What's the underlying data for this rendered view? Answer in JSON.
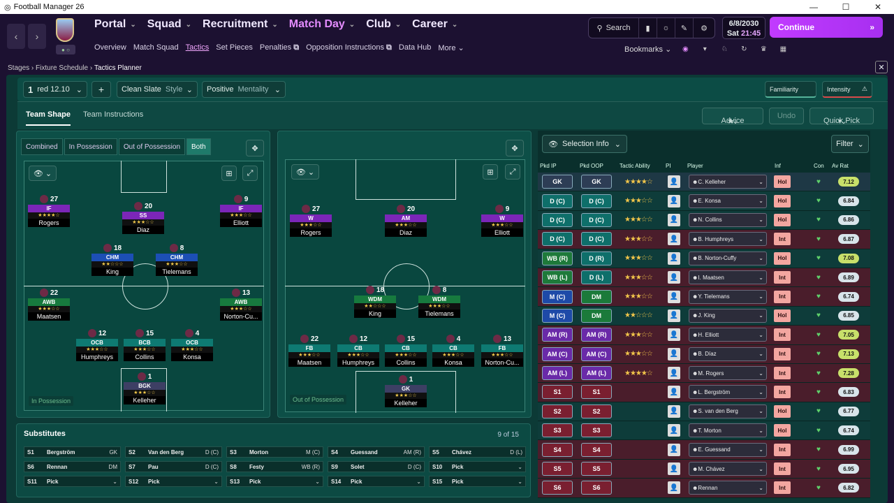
{
  "window": {
    "title": "Football Manager 26"
  },
  "nav": {
    "main": [
      {
        "label": "Portal"
      },
      {
        "label": "Squad"
      },
      {
        "label": "Recruitment"
      },
      {
        "label": "Match Day"
      },
      {
        "label": "Club"
      },
      {
        "label": "Career"
      }
    ],
    "sub": [
      "Overview",
      "Match Squad",
      "Tactics",
      "Set Pieces",
      "Penalties",
      "Opposition Instructions",
      "Data Hub",
      "More"
    ],
    "search": "Search",
    "bookmarks": "Bookmarks",
    "date": "6/8/2030",
    "day": "Sat",
    "time": "21:45",
    "continue": "Continue"
  },
  "breadcrumb": [
    "Stages",
    "Fixture Schedule",
    "Tactics Planner"
  ],
  "toolbar": {
    "tactic_slot": "1",
    "tactic_name": "red 12.10",
    "style": "Clean Slate",
    "style_label": "Style",
    "mentality": "Positive",
    "mentality_label": "Mentality",
    "familiarity": "Familiarity",
    "intensity": "Intensity"
  },
  "tabs": {
    "team_shape": "Team Shape",
    "team_instructions": "Team Instructions",
    "advice": "Advice",
    "undo": "Undo",
    "quick_pick": "Quick Pick"
  },
  "view_modes": [
    "Combined",
    "In Possession",
    "Out of Possession",
    "Both"
  ],
  "pitch_labels": {
    "in": "In Possession",
    "out": "Out of Possession"
  },
  "in_possession": [
    {
      "num": "27",
      "role": "IF",
      "name": "Rogers",
      "stars": "★★★★☆"
    },
    {
      "num": "20",
      "role": "SS",
      "name": "Diaz",
      "stars": "★★★☆☆"
    },
    {
      "num": "9",
      "role": "IF",
      "name": "Elliott",
      "stars": "★★★☆☆"
    },
    {
      "num": "18",
      "role": "CHM",
      "name": "King",
      "stars": "★★☆☆☆"
    },
    {
      "num": "8",
      "role": "CHM",
      "name": "Tielemans",
      "stars": "★★★☆☆"
    },
    {
      "num": "22",
      "role": "AWB",
      "name": "Maatsen",
      "stars": "★★★☆☆"
    },
    {
      "num": "13",
      "role": "AWB",
      "name": "Norton-Cu...",
      "stars": "★★★☆☆"
    },
    {
      "num": "12",
      "role": "OCB",
      "name": "Humphreys",
      "stars": "★★★☆☆"
    },
    {
      "num": "15",
      "role": "BCB",
      "name": "Collins",
      "stars": "★★★☆☆"
    },
    {
      "num": "4",
      "role": "OCB",
      "name": "Konsa",
      "stars": "★★★☆☆"
    },
    {
      "num": "1",
      "role": "BGK",
      "name": "Kelleher",
      "stars": "★★★☆☆"
    }
  ],
  "out_possession": [
    {
      "num": "27",
      "role": "W",
      "name": "Rogers",
      "stars": "★★★☆☆"
    },
    {
      "num": "20",
      "role": "AM",
      "name": "Diaz",
      "stars": "★★★☆☆"
    },
    {
      "num": "9",
      "role": "W",
      "name": "Elliott",
      "stars": "★★★☆☆"
    },
    {
      "num": "18",
      "role": "WDM",
      "name": "King",
      "stars": "★★☆☆☆"
    },
    {
      "num": "8",
      "role": "WDM",
      "name": "Tielemans",
      "stars": "★★★☆☆"
    },
    {
      "num": "22",
      "role": "FB",
      "name": "Maatsen",
      "stars": "★★★☆☆"
    },
    {
      "num": "12",
      "role": "CB",
      "name": "Humphreys",
      "stars": "★★★☆☆"
    },
    {
      "num": "15",
      "role": "CB",
      "name": "Collins",
      "stars": "★★★☆☆"
    },
    {
      "num": "4",
      "role": "CB",
      "name": "Konsa",
      "stars": "★★★☆☆"
    },
    {
      "num": "13",
      "role": "FB",
      "name": "Norton-Cu...",
      "stars": "★★★☆☆"
    },
    {
      "num": "1",
      "role": "GK",
      "name": "Kelleher",
      "stars": "★★★☆☆"
    }
  ],
  "substitutes": {
    "title": "Substitutes",
    "count": "9 of 15",
    "items": [
      {
        "slot": "S1",
        "name": "Bergström",
        "pos": "GK"
      },
      {
        "slot": "S2",
        "name": "Van den Berg",
        "pos": "D (C)"
      },
      {
        "slot": "S3",
        "name": "Morton",
        "pos": "M (C)"
      },
      {
        "slot": "S4",
        "name": "Guessand",
        "pos": "AM (R)"
      },
      {
        "slot": "S5",
        "name": "Chávez",
        "pos": "D (L)"
      },
      {
        "slot": "S6",
        "name": "Rennan",
        "pos": "DM"
      },
      {
        "slot": "S7",
        "name": "Pau",
        "pos": "D (C)"
      },
      {
        "slot": "S8",
        "name": "Festy",
        "pos": "WB (R)"
      },
      {
        "slot": "S9",
        "name": "Solet",
        "pos": "D (C)"
      },
      {
        "slot": "S10",
        "name": "Pick",
        "pos": ""
      },
      {
        "slot": "S11",
        "name": "Pick",
        "pos": ""
      },
      {
        "slot": "S12",
        "name": "Pick",
        "pos": ""
      },
      {
        "slot": "S13",
        "name": "Pick",
        "pos": ""
      },
      {
        "slot": "S14",
        "name": "Pick",
        "pos": ""
      },
      {
        "slot": "S15",
        "name": "Pick",
        "pos": ""
      }
    ]
  },
  "selection": {
    "info": "Selection Info",
    "filter": "Filter",
    "headers": [
      "Pkd IP",
      "Pkd OOP",
      "Tactic Ability",
      "PI",
      "Player",
      "Inf",
      "Con",
      "Av Rat"
    ],
    "rows": [
      {
        "ip": "GK",
        "oop": "GK",
        "stars": "★★★★☆",
        "player": "C. Kelleher",
        "inf": "Hol",
        "rat": "7.12",
        "ip_color": "#2d3d55",
        "oop_color": "#2d3d55",
        "row_color": "#1e3845",
        "rat_color": "#c8e06a"
      },
      {
        "ip": "D (C)",
        "oop": "D (C)",
        "stars": "★★★☆☆",
        "player": "E. Konsa",
        "inf": "Hol",
        "rat": "6.84",
        "ip_color": "#0e6f6a",
        "oop_color": "#0e6f6a",
        "row_color": "#0e3c3a",
        "rat_color": "#d8e4ea"
      },
      {
        "ip": "D (C)",
        "oop": "D (C)",
        "stars": "★★★☆☆",
        "player": "N. Collins",
        "inf": "Hol",
        "rat": "6.86",
        "ip_color": "#0e6f6a",
        "oop_color": "#0e6f6a",
        "row_color": "#0e3c3a",
        "rat_color": "#d8e4ea"
      },
      {
        "ip": "D (C)",
        "oop": "D (C)",
        "stars": "★★★☆☆",
        "player": "B. Humphreys",
        "inf": "Int",
        "rat": "6.87",
        "ip_color": "#0e6f6a",
        "oop_color": "#0e6f6a",
        "row_color": "#4a1d2b",
        "rat_color": "#d8e4ea"
      },
      {
        "ip": "WB (R)",
        "oop": "D (R)",
        "stars": "★★★☆☆",
        "player": "B. Norton-Cuffy",
        "inf": "Hol",
        "rat": "7.08",
        "ip_color": "#1e7a3a",
        "oop_color": "#0e6f6a",
        "row_color": "#0e3c3a",
        "rat_color": "#c8e06a"
      },
      {
        "ip": "WB (L)",
        "oop": "D (L)",
        "stars": "★★★☆☆",
        "player": "I. Maatsen",
        "inf": "Int",
        "rat": "6.89",
        "ip_color": "#1e7a3a",
        "oop_color": "#0e6f6a",
        "row_color": "#4a1d2b",
        "rat_color": "#d8e4ea"
      },
      {
        "ip": "M (C)",
        "oop": "DM",
        "stars": "★★★☆☆",
        "player": "Y. Tielemans",
        "inf": "Int",
        "rat": "6.74",
        "ip_color": "#1e4aa8",
        "oop_color": "#1b7a3a",
        "row_color": "#4a1d2b",
        "rat_color": "#d8e4ea"
      },
      {
        "ip": "M (C)",
        "oop": "DM",
        "stars": "★★☆☆☆",
        "player": "J. King",
        "inf": "Hol",
        "rat": "6.85",
        "ip_color": "#1e4aa8",
        "oop_color": "#1b7a3a",
        "row_color": "#0e3c3a",
        "rat_color": "#d8e4ea"
      },
      {
        "ip": "AM (R)",
        "oop": "AM (R)",
        "stars": "★★★☆☆",
        "player": "H. Elliott",
        "inf": "Int",
        "rat": "7.05",
        "ip_color": "#6a2aa8",
        "oop_color": "#6a2aa8",
        "row_color": "#4a1d2b",
        "rat_color": "#c8e06a"
      },
      {
        "ip": "AM (C)",
        "oop": "AM (C)",
        "stars": "★★★☆☆",
        "player": "B. Díaz",
        "inf": "Int",
        "rat": "7.13",
        "ip_color": "#6a2aa8",
        "oop_color": "#6a2aa8",
        "row_color": "#4a1d2b",
        "rat_color": "#c8e06a"
      },
      {
        "ip": "AM (L)",
        "oop": "AM (L)",
        "stars": "★★★★☆",
        "player": "M. Rogers",
        "inf": "Int",
        "rat": "7.28",
        "ip_color": "#6a2aa8",
        "oop_color": "#6a2aa8",
        "row_color": "#4a1d2b",
        "rat_color": "#c8e06a"
      },
      {
        "ip": "S1",
        "oop": "S1",
        "stars": "",
        "player": "L. Bergström",
        "inf": "Int",
        "rat": "6.83",
        "ip_color": "#7a1f30",
        "oop_color": "#7a1f30",
        "row_color": "#4a1d2b",
        "rat_color": "#d8e4ea"
      },
      {
        "ip": "S2",
        "oop": "S2",
        "stars": "",
        "player": "S. van den Berg",
        "inf": "Hol",
        "rat": "6.77",
        "ip_color": "#7a1f30",
        "oop_color": "#7a1f30",
        "row_color": "#0e3c3a",
        "rat_color": "#d8e4ea"
      },
      {
        "ip": "S3",
        "oop": "S3",
        "stars": "",
        "player": "T. Morton",
        "inf": "Hol",
        "rat": "6.74",
        "ip_color": "#7a1f30",
        "oop_color": "#7a1f30",
        "row_color": "#0e3c3a",
        "rat_color": "#d8e4ea"
      },
      {
        "ip": "S4",
        "oop": "S4",
        "stars": "",
        "player": "E. Guessand",
        "inf": "Int",
        "rat": "6.99",
        "ip_color": "#7a1f30",
        "oop_color": "#7a1f30",
        "row_color": "#4a1d2b",
        "rat_color": "#d8e4ea"
      },
      {
        "ip": "S5",
        "oop": "S5",
        "stars": "",
        "player": "M. Chávez",
        "inf": "Int",
        "rat": "6.95",
        "ip_color": "#7a1f30",
        "oop_color": "#7a1f30",
        "row_color": "#4a1d2b",
        "rat_color": "#d8e4ea"
      },
      {
        "ip": "S6",
        "oop": "S6",
        "stars": "",
        "player": "Rennan",
        "inf": "Int",
        "rat": "6.82",
        "ip_color": "#7a1f30",
        "oop_color": "#7a1f30",
        "row_color": "#4a1d2b",
        "rat_color": "#d8e4ea"
      }
    ]
  }
}
